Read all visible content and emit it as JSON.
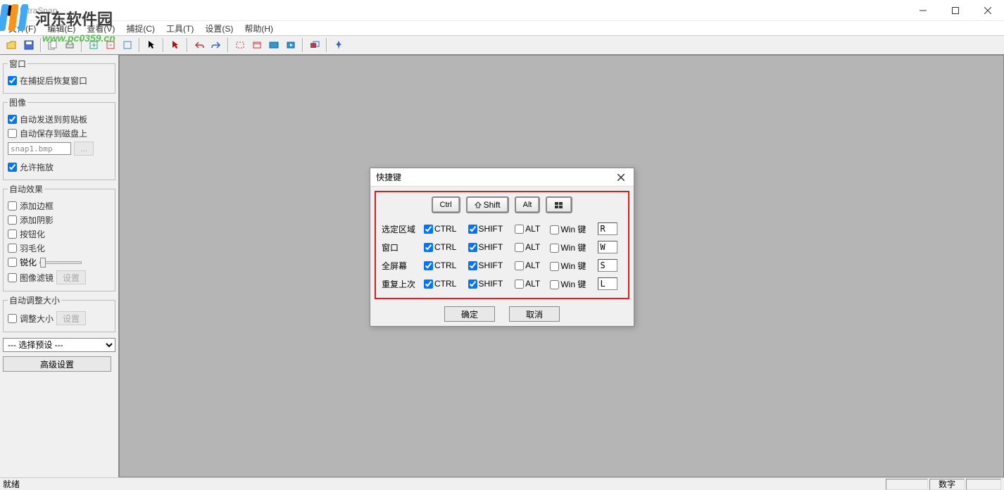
{
  "app": {
    "title": "UltraSnap"
  },
  "watermark": {
    "text": "河东软件园",
    "url": "www.pc0359.cn"
  },
  "menu": {
    "file": "文件(F)",
    "edit": "编辑(E)",
    "view": "查看(V)",
    "capture": "捕捉(C)",
    "tools": "工具(T)",
    "settings": "设置(S)",
    "help": "帮助(H)"
  },
  "sidebar": {
    "group_window": {
      "legend": "窗口",
      "restore_after_capture": "在捕捉后恢复窗口"
    },
    "group_image": {
      "legend": "图像",
      "auto_clipboard": "自动发送到剪贴板",
      "auto_save": "自动保存到磁盘上",
      "filename": "snap1.bmp",
      "browse": "...",
      "allow_drag": "允许拖放"
    },
    "group_effects": {
      "legend": "自动效果",
      "add_border": "添加边框",
      "add_shadow": "添加阴影",
      "buttonize": "按钮化",
      "feather": "羽毛化",
      "sharpen": "锐化",
      "image_filter": "图像滤镜",
      "settings_btn": "设置"
    },
    "group_resize": {
      "legend": "自动调整大小",
      "resize": "调整大小",
      "settings_btn": "设置"
    },
    "preset_placeholder": "--- 选择预设 ---",
    "advanced": "高级设置"
  },
  "dialog": {
    "title": "快捷键",
    "keys": {
      "ctrl": "Ctrl",
      "shift": "Shift",
      "alt": "Alt"
    },
    "cols": {
      "ctrl": "CTRL",
      "shift": "SHIFT",
      "alt": "ALT",
      "win": "Win 键"
    },
    "rows": [
      {
        "label": "选定区域",
        "ctrl": true,
        "shift": true,
        "alt": false,
        "win": false,
        "key": "R"
      },
      {
        "label": "窗口",
        "ctrl": true,
        "shift": true,
        "alt": false,
        "win": false,
        "key": "W"
      },
      {
        "label": "全屏幕",
        "ctrl": true,
        "shift": true,
        "alt": false,
        "win": false,
        "key": "S"
      },
      {
        "label": "重复上次",
        "ctrl": true,
        "shift": true,
        "alt": false,
        "win": false,
        "key": "L"
      }
    ],
    "ok": "确定",
    "cancel": "取消"
  },
  "status": {
    "ready": "就绪",
    "numlock": "数字"
  }
}
